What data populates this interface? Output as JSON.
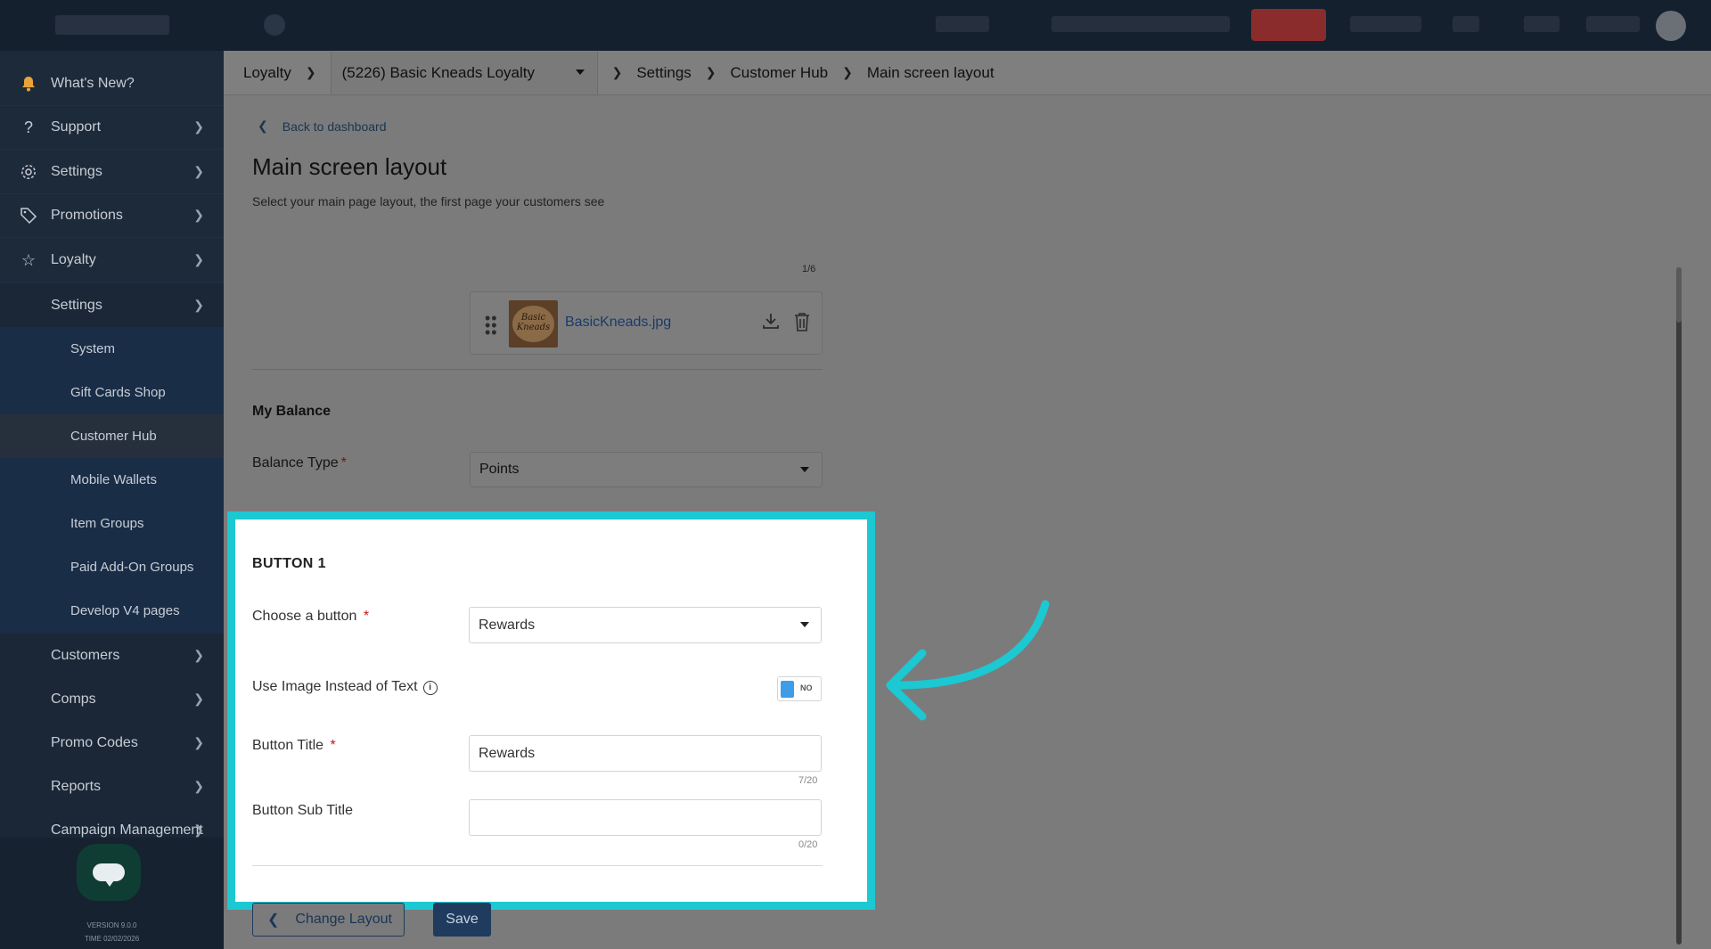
{
  "sidebar": {
    "items": [
      {
        "label": "What's New?",
        "icon": "bell-icon"
      },
      {
        "label": "Support",
        "icon": "question-icon"
      },
      {
        "label": "Settings",
        "icon": "gear-icon"
      },
      {
        "label": "Promotions",
        "icon": "tag-icon"
      },
      {
        "label": "Loyalty",
        "icon": "star-icon"
      }
    ],
    "loyalty_settings": "Settings",
    "settings_sub": [
      "System",
      "Gift Cards Shop",
      "Customer Hub",
      "Mobile Wallets",
      "Item Groups",
      "Paid Add-On Groups",
      "Develop V4 pages"
    ],
    "loyalty_more": [
      "Customers",
      "Comps",
      "Promo Codes",
      "Reports",
      "Campaign Management"
    ],
    "version": "VERSION 9.0.0",
    "time": "TIME 02/02/2026"
  },
  "breadcrumb": {
    "root": "Loyalty",
    "program": "(5226) Basic Kneads Loyalty",
    "settings": "Settings",
    "hub": "Customer Hub",
    "current": "Main screen layout"
  },
  "page": {
    "back_link": "Back to dashboard",
    "title": "Main screen layout",
    "subtitle": "Select your main page layout, the first page your customers see",
    "scroll_fragment": "1/6"
  },
  "file": {
    "name": "BasicKneads.jpg",
    "thumb_text": "Basic Kneads"
  },
  "balance": {
    "heading": "My Balance",
    "type_label": "Balance Type",
    "type_value": "Points"
  },
  "button1": {
    "heading": "BUTTON 1",
    "choose_label": "Choose a button",
    "choose_value": "Rewards",
    "use_image_label": "Use Image Instead of Text",
    "toggle_state": "NO",
    "title_label": "Button Title",
    "title_value": "Rewards",
    "title_counter": "7/20",
    "subtitle_label": "Button Sub Title",
    "subtitle_value": "",
    "subtitle_counter": "0/20"
  },
  "footer": {
    "change_layout": "Change Layout",
    "save": "Save"
  },
  "colors": {
    "highlight": "#1cc8d1",
    "toggle_on": "#3d9de8",
    "sidebar_bg": "#1d2a3a",
    "required": "#c81414"
  }
}
